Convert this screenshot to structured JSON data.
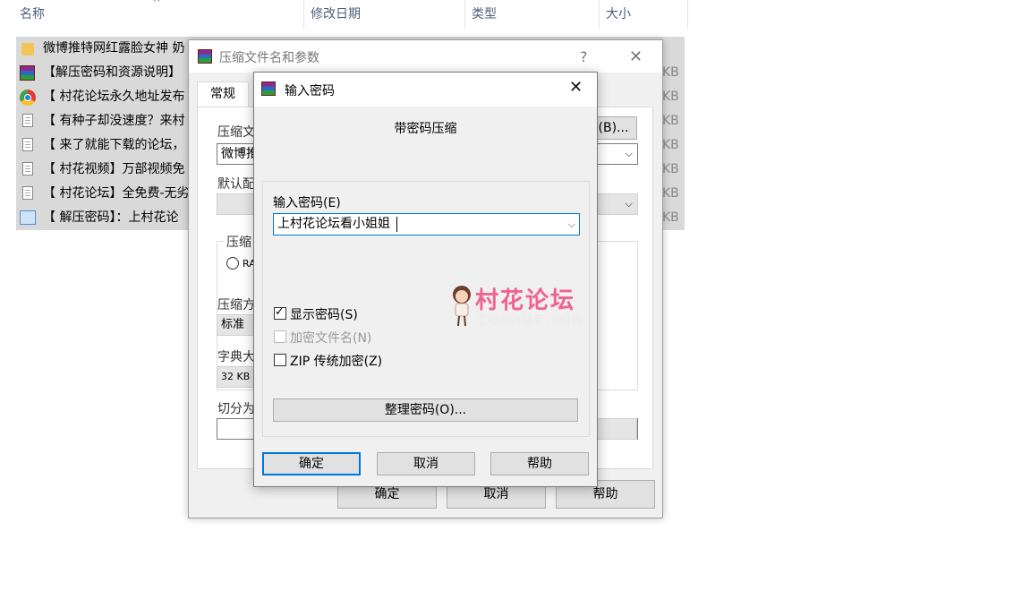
{
  "explorer": {
    "columns": [
      "名称",
      "修改日期",
      "类型",
      "大小"
    ],
    "sort_indicator": "^",
    "files": [
      {
        "name": "微博推特网红露脸女神 奶",
        "icon": "folder-icon",
        "size": ""
      },
      {
        "name": "【解压密码和资源说明】",
        "icon": "rar-icon",
        "size": "KB"
      },
      {
        "name": "【 村花论坛永久地址发布",
        "icon": "chrome-icon",
        "size": "KB"
      },
      {
        "name": "【 有种子却没速度？来村",
        "icon": "text-file-icon",
        "size": "KB"
      },
      {
        "name": "【 来了就能下载的论坛，",
        "icon": "text-file-icon",
        "size": "KB"
      },
      {
        "name": "【 村花视频】万部视频免",
        "icon": "text-file-icon",
        "size": "KB"
      },
      {
        "name": "【 村花论坛】全免费-无劣",
        "icon": "text-file-icon",
        "size": "KB"
      },
      {
        "name": "【 解压密码】：上村花论",
        "icon": "url-file-icon",
        "size": "KB"
      }
    ]
  },
  "archive_dialog": {
    "title": "压缩文件名和参数",
    "help_glyph": "?",
    "close_glyph": "✕",
    "tab_general": "常规",
    "archive_name_label": "压缩文",
    "archive_name_value": "微博推",
    "browse_button": "(B)...",
    "default_profile_label": "默认配",
    "format_group_label": "压缩",
    "format_rar_option": "RA",
    "method_label": "压缩方",
    "method_value": "标准",
    "dict_label": "字典大",
    "dict_value": "32 KB",
    "split_label": "切分为",
    "ok_button": "确定",
    "cancel_button": "取消",
    "help_button": "帮助"
  },
  "password_dialog": {
    "title": "输入密码",
    "close_glyph": "✕",
    "heading": "带密码压缩",
    "password_label": "输入密码",
    "password_hotkey": "(E)",
    "password_value": "上村花论坛看小姐姐",
    "show_password_label": "显示密码",
    "show_password_hotkey": "(S)",
    "show_password_checked": true,
    "encrypt_names_label": "加密文件名",
    "encrypt_names_hotkey": "(N)",
    "encrypt_names_enabled": false,
    "zip_legacy_label": "ZIP 传统加密",
    "zip_legacy_hotkey": "(Z)",
    "zip_legacy_checked": false,
    "organize_button": "整理密码(O)...",
    "ok_button": "确定",
    "cancel_button": "取消",
    "help_button": "帮助"
  },
  "watermark": {
    "text": "村花论坛",
    "url": "cunhua.win"
  },
  "colors": {
    "accent": "#0078d7",
    "selection_row": "#d9d9d9",
    "watermark_pink": "#f06292"
  }
}
